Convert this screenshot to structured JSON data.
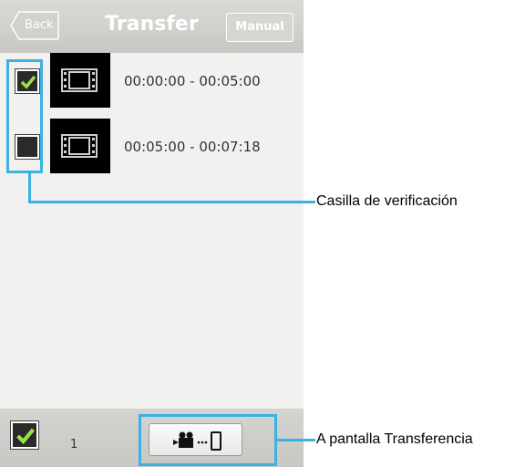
{
  "header": {
    "title": "Transfer",
    "back_label": "Back",
    "manual_label": "Manual"
  },
  "items": [
    {
      "checked": true,
      "time_range": "00:00:00 - 00:05:00",
      "thumb_icon": "film-icon"
    },
    {
      "checked": false,
      "time_range": "00:05:00 - 00:07:18",
      "thumb_icon": "film-icon"
    }
  ],
  "footer": {
    "selected_count": "1",
    "select_all_checked": true,
    "transfer_icon": "camera-to-phone-icon"
  },
  "annotations": {
    "checkbox_label": "Casilla de verificación",
    "transfer_label": "A pantalla Transferencia"
  },
  "colors": {
    "highlight": "#3ab2e2",
    "checkbox_fill": "#2a2a2a",
    "check_mark": "#9be04b"
  }
}
